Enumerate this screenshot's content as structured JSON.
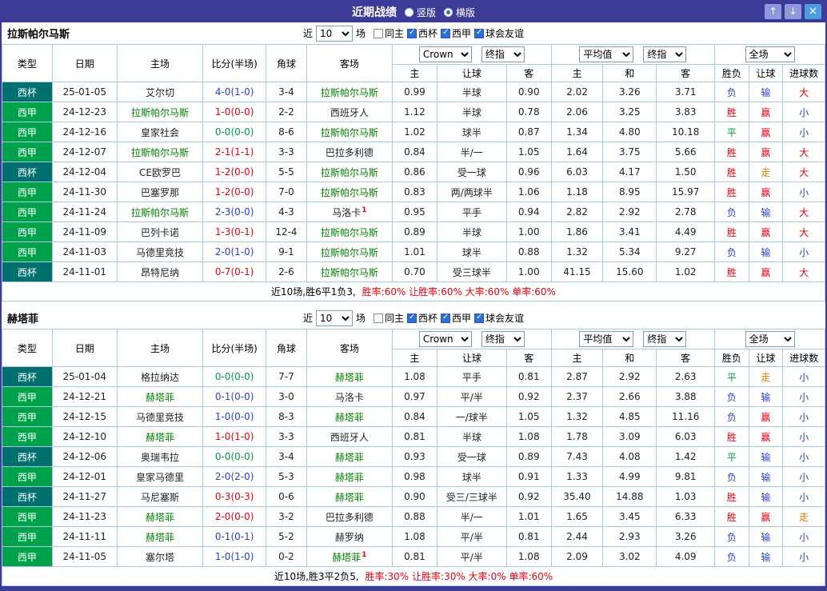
{
  "titlebar": {
    "title": "近期战绩",
    "radios": [
      {
        "label": "竖版",
        "state": ""
      },
      {
        "label": "横版",
        "state": "on"
      }
    ],
    "up_button": "↑",
    "down_button": "↓",
    "close_button": "×"
  },
  "controls": {
    "recent_label": "近",
    "recent_value": "10",
    "games_label": "场",
    "checkboxes": [
      {
        "label": "同主",
        "state": ""
      },
      {
        "label": "西杯",
        "state": "checked"
      },
      {
        "label": "西甲",
        "state": "checked"
      },
      {
        "label": "球会友谊",
        "state": "checked"
      }
    ],
    "bookmaker": "Crown",
    "final_label": "终指",
    "average_label": "平均值",
    "fullmatch_label": "全场"
  },
  "columns": {
    "type": "类型",
    "date": "日期",
    "home": "主场",
    "score": "比分(半场)",
    "corner": "角球",
    "away": "客场",
    "sub": [
      "主",
      "让球",
      "客",
      "主",
      "和",
      "客",
      "胜负",
      "让球",
      "进球数"
    ]
  },
  "sections": [
    {
      "team": "拉斯帕尔马斯",
      "summary_prefix": "近10场,胜6平1负3,",
      "summary_stats": "胜率:60% 让胜率:60% 大率:60% 单率:60%",
      "rows": [
        {
          "type": "西杯",
          "tc": "cup",
          "date": "25-01-05",
          "home": "艾尔切",
          "hf": false,
          "hb": "",
          "score": "4-0(1-0)",
          "sc": "c-blue",
          "corner": "3-4",
          "away": "拉斯帕尔马斯",
          "af": true,
          "ab": "",
          "o1": [
            "0.99",
            "半球",
            "0.90"
          ],
          "o2": [
            "2.02",
            "3.26",
            "3.71"
          ],
          "r": [
            "负",
            "输",
            "大"
          ],
          "rc": [
            "c-blue",
            "c-blue",
            "c-red"
          ]
        },
        {
          "type": "西甲",
          "tc": "liga",
          "date": "24-12-23",
          "home": "拉斯帕尔马斯",
          "hf": true,
          "hb": "",
          "score": "1-0(0-0)",
          "sc": "c-red",
          "corner": "2-2",
          "away": "西班牙人",
          "af": false,
          "ab": "",
          "o1": [
            "1.12",
            "半球",
            "0.78"
          ],
          "o2": [
            "2.06",
            "3.25",
            "3.83"
          ],
          "r": [
            "胜",
            "赢",
            "小"
          ],
          "rc": [
            "c-red",
            "c-red",
            "c-blue"
          ]
        },
        {
          "type": "西甲",
          "tc": "liga",
          "date": "24-12-16",
          "home": "皇家社会",
          "hf": false,
          "hb": "",
          "score": "0-0(0-0)",
          "sc": "c-green",
          "corner": "8-6",
          "away": "拉斯帕尔马斯",
          "af": true,
          "ab": "",
          "o1": [
            "1.02",
            "球半",
            "0.87"
          ],
          "o2": [
            "1.34",
            "4.80",
            "10.18"
          ],
          "r": [
            "平",
            "赢",
            "小"
          ],
          "rc": [
            "c-green",
            "c-red",
            "c-blue"
          ]
        },
        {
          "type": "西甲",
          "tc": "liga",
          "date": "24-12-07",
          "home": "拉斯帕尔马斯",
          "hf": true,
          "hb": "",
          "score": "2-1(1-1)",
          "sc": "c-red",
          "corner": "3-3",
          "away": "巴拉多利德",
          "af": false,
          "ab": "",
          "o1": [
            "0.84",
            "半/一",
            "1.05"
          ],
          "o2": [
            "1.64",
            "3.75",
            "5.66"
          ],
          "r": [
            "胜",
            "赢",
            "大"
          ],
          "rc": [
            "c-red",
            "c-red",
            "c-red"
          ]
        },
        {
          "type": "西杯",
          "tc": "cup",
          "date": "24-12-04",
          "home": "CE欧罗巴",
          "hf": false,
          "hb": "",
          "score": "1-2(0-0)",
          "sc": "c-red",
          "corner": "5-5",
          "away": "拉斯帕尔马斯",
          "af": true,
          "ab": "",
          "o1": [
            "0.86",
            "受一球",
            "0.96"
          ],
          "o2": [
            "6.03",
            "4.17",
            "1.50"
          ],
          "r": [
            "胜",
            "走",
            "大"
          ],
          "rc": [
            "c-red",
            "c-orange",
            "c-red"
          ]
        },
        {
          "type": "西甲",
          "tc": "liga",
          "date": "24-11-30",
          "home": "巴塞罗那",
          "hf": false,
          "hb": "",
          "score": "1-2(0-0)",
          "sc": "c-red",
          "corner": "7-0",
          "away": "拉斯帕尔马斯",
          "af": true,
          "ab": "",
          "o1": [
            "0.83",
            "两/两球半",
            "1.06"
          ],
          "o2": [
            "1.18",
            "8.95",
            "15.97"
          ],
          "r": [
            "胜",
            "赢",
            "小"
          ],
          "rc": [
            "c-red",
            "c-red",
            "c-blue"
          ]
        },
        {
          "type": "西甲",
          "tc": "liga",
          "date": "24-11-24",
          "home": "拉斯帕尔马斯",
          "hf": true,
          "hb": "",
          "score": "2-3(0-0)",
          "sc": "c-blue",
          "corner": "4-3",
          "away": "马洛卡",
          "af": false,
          "ab": "1",
          "o1": [
            "0.95",
            "平手",
            "0.94"
          ],
          "o2": [
            "2.82",
            "2.92",
            "2.78"
          ],
          "r": [
            "负",
            "输",
            "大"
          ],
          "rc": [
            "c-blue",
            "c-blue",
            "c-red"
          ]
        },
        {
          "type": "西甲",
          "tc": "liga",
          "date": "24-11-09",
          "home": "巴列卡诺",
          "hf": false,
          "hb": "",
          "score": "1-3(0-1)",
          "sc": "c-red",
          "corner": "12-4",
          "away": "拉斯帕尔马斯",
          "af": true,
          "ab": "",
          "o1": [
            "0.89",
            "半球",
            "1.00"
          ],
          "o2": [
            "1.86",
            "3.41",
            "4.49"
          ],
          "r": [
            "胜",
            "赢",
            "大"
          ],
          "rc": [
            "c-red",
            "c-red",
            "c-red"
          ]
        },
        {
          "type": "西甲",
          "tc": "liga",
          "date": "24-11-03",
          "home": "马德里竞技",
          "hf": false,
          "hb": "",
          "score": "2-0(1-0)",
          "sc": "c-blue",
          "corner": "9-1",
          "away": "拉斯帕尔马斯",
          "af": true,
          "ab": "",
          "o1": [
            "1.01",
            "球半",
            "0.88"
          ],
          "o2": [
            "1.32",
            "5.34",
            "9.27"
          ],
          "r": [
            "负",
            "输",
            "小"
          ],
          "rc": [
            "c-blue",
            "c-blue",
            "c-blue"
          ]
        },
        {
          "type": "西杯",
          "tc": "cup",
          "date": "24-11-01",
          "home": "昂特尼纳",
          "hf": false,
          "hb": "",
          "score": "0-7(0-1)",
          "sc": "c-red",
          "corner": "2-6",
          "away": "拉斯帕尔马斯",
          "af": true,
          "ab": "",
          "o1": [
            "0.70",
            "受三球半",
            "1.00"
          ],
          "o2": [
            "41.15",
            "15.60",
            "1.02"
          ],
          "r": [
            "胜",
            "赢",
            "大"
          ],
          "rc": [
            "c-red",
            "c-red",
            "c-red"
          ]
        }
      ]
    },
    {
      "team": "赫塔菲",
      "summary_prefix": "近10场,胜3平2负5,",
      "summary_stats": "胜率:30% 让胜率:30% 大率:0% 单率:60%",
      "rows": [
        {
          "type": "西杯",
          "tc": "cup",
          "date": "25-01-04",
          "home": "格拉纳达",
          "hf": false,
          "hb": "",
          "score": "0-0(0-0)",
          "sc": "c-green",
          "corner": "7-7",
          "away": "赫塔菲",
          "af": true,
          "ab": "",
          "o1": [
            "1.08",
            "平手",
            "0.81"
          ],
          "o2": [
            "2.87",
            "2.92",
            "2.63"
          ],
          "r": [
            "平",
            "走",
            "小"
          ],
          "rc": [
            "c-green",
            "c-orange",
            "c-blue"
          ]
        },
        {
          "type": "西甲",
          "tc": "liga",
          "date": "24-12-21",
          "home": "赫塔菲",
          "hf": true,
          "hb": "",
          "score": "0-1(0-0)",
          "sc": "c-blue",
          "corner": "3-0",
          "away": "马洛卡",
          "af": false,
          "ab": "",
          "o1": [
            "0.97",
            "平/半",
            "0.92"
          ],
          "o2": [
            "2.37",
            "2.66",
            "3.88"
          ],
          "r": [
            "负",
            "输",
            "小"
          ],
          "rc": [
            "c-blue",
            "c-blue",
            "c-blue"
          ]
        },
        {
          "type": "西甲",
          "tc": "liga",
          "date": "24-12-15",
          "home": "马德里竞技",
          "hf": false,
          "hb": "",
          "score": "1-0(0-0)",
          "sc": "c-blue",
          "corner": "8-3",
          "away": "赫塔菲",
          "af": true,
          "ab": "",
          "o1": [
            "0.84",
            "一/球半",
            "1.05"
          ],
          "o2": [
            "1.32",
            "4.85",
            "11.16"
          ],
          "r": [
            "负",
            "赢",
            "小"
          ],
          "rc": [
            "c-blue",
            "c-red",
            "c-blue"
          ]
        },
        {
          "type": "西甲",
          "tc": "liga",
          "date": "24-12-10",
          "home": "赫塔菲",
          "hf": true,
          "hb": "",
          "score": "1-0(1-0)",
          "sc": "c-red",
          "corner": "3-3",
          "away": "西班牙人",
          "af": false,
          "ab": "",
          "o1": [
            "0.81",
            "半球",
            "1.08"
          ],
          "o2": [
            "1.78",
            "3.09",
            "6.03"
          ],
          "r": [
            "胜",
            "赢",
            "小"
          ],
          "rc": [
            "c-red",
            "c-red",
            "c-blue"
          ]
        },
        {
          "type": "西杯",
          "tc": "cup",
          "date": "24-12-06",
          "home": "奥瑞韦拉",
          "hf": false,
          "hb": "",
          "score": "0-0(0-0)",
          "sc": "c-green",
          "corner": "3-4",
          "away": "赫塔菲",
          "af": true,
          "ab": "",
          "o1": [
            "0.93",
            "受一球",
            "0.89"
          ],
          "o2": [
            "7.43",
            "4.08",
            "1.42"
          ],
          "r": [
            "平",
            "输",
            "小"
          ],
          "rc": [
            "c-green",
            "c-blue",
            "c-blue"
          ]
        },
        {
          "type": "西甲",
          "tc": "liga",
          "date": "24-12-01",
          "home": "皇家马德里",
          "hf": false,
          "hb": "",
          "score": "2-0(2-0)",
          "sc": "c-blue",
          "corner": "5-3",
          "away": "赫塔菲",
          "af": true,
          "ab": "",
          "o1": [
            "0.98",
            "球半",
            "0.91"
          ],
          "o2": [
            "1.33",
            "4.99",
            "9.81"
          ],
          "r": [
            "负",
            "输",
            "小"
          ],
          "rc": [
            "c-blue",
            "c-blue",
            "c-blue"
          ]
        },
        {
          "type": "西杯",
          "tc": "cup",
          "date": "24-11-27",
          "home": "马尼塞斯",
          "hf": false,
          "hb": "",
          "score": "0-3(0-3)",
          "sc": "c-red",
          "corner": "0-6",
          "away": "赫塔菲",
          "af": true,
          "ab": "",
          "o1": [
            "0.90",
            "受三/三球半",
            "0.92"
          ],
          "o2": [
            "35.40",
            "14.88",
            "1.03"
          ],
          "r": [
            "胜",
            "输",
            "小"
          ],
          "rc": [
            "c-red",
            "c-blue",
            "c-blue"
          ]
        },
        {
          "type": "西甲",
          "tc": "liga",
          "date": "24-11-23",
          "home": "赫塔菲",
          "hf": true,
          "hb": "",
          "score": "2-0(0-0)",
          "sc": "c-red",
          "corner": "3-2",
          "away": "巴拉多利德",
          "af": false,
          "ab": "",
          "o1": [
            "0.88",
            "半/一",
            "1.01"
          ],
          "o2": [
            "1.65",
            "3.45",
            "6.33"
          ],
          "r": [
            "胜",
            "赢",
            "走"
          ],
          "rc": [
            "c-red",
            "c-red",
            "c-orange"
          ]
        },
        {
          "type": "西甲",
          "tc": "liga",
          "date": "24-11-11",
          "home": "赫塔菲",
          "hf": true,
          "hb": "",
          "score": "0-1(0-1)",
          "sc": "c-blue",
          "corner": "5-2",
          "away": "赫罗纳",
          "af": false,
          "ab": "",
          "o1": [
            "1.08",
            "平/半",
            "0.81"
          ],
          "o2": [
            "2.44",
            "2.93",
            "3.26"
          ],
          "r": [
            "负",
            "输",
            "小"
          ],
          "rc": [
            "c-blue",
            "c-blue",
            "c-blue"
          ]
        },
        {
          "type": "西甲",
          "tc": "liga",
          "date": "24-11-05",
          "home": "塞尔塔",
          "hf": false,
          "hb": "",
          "score": "1-0(1-0)",
          "sc": "c-blue",
          "corner": "0-2",
          "away": "赫塔菲",
          "af": true,
          "ab": "1",
          "o1": [
            "0.81",
            "平/半",
            "1.08"
          ],
          "o2": [
            "2.09",
            "3.02",
            "4.09"
          ],
          "r": [
            "负",
            "输",
            "小"
          ],
          "rc": [
            "c-blue",
            "c-blue",
            "c-blue"
          ]
        }
      ]
    }
  ]
}
